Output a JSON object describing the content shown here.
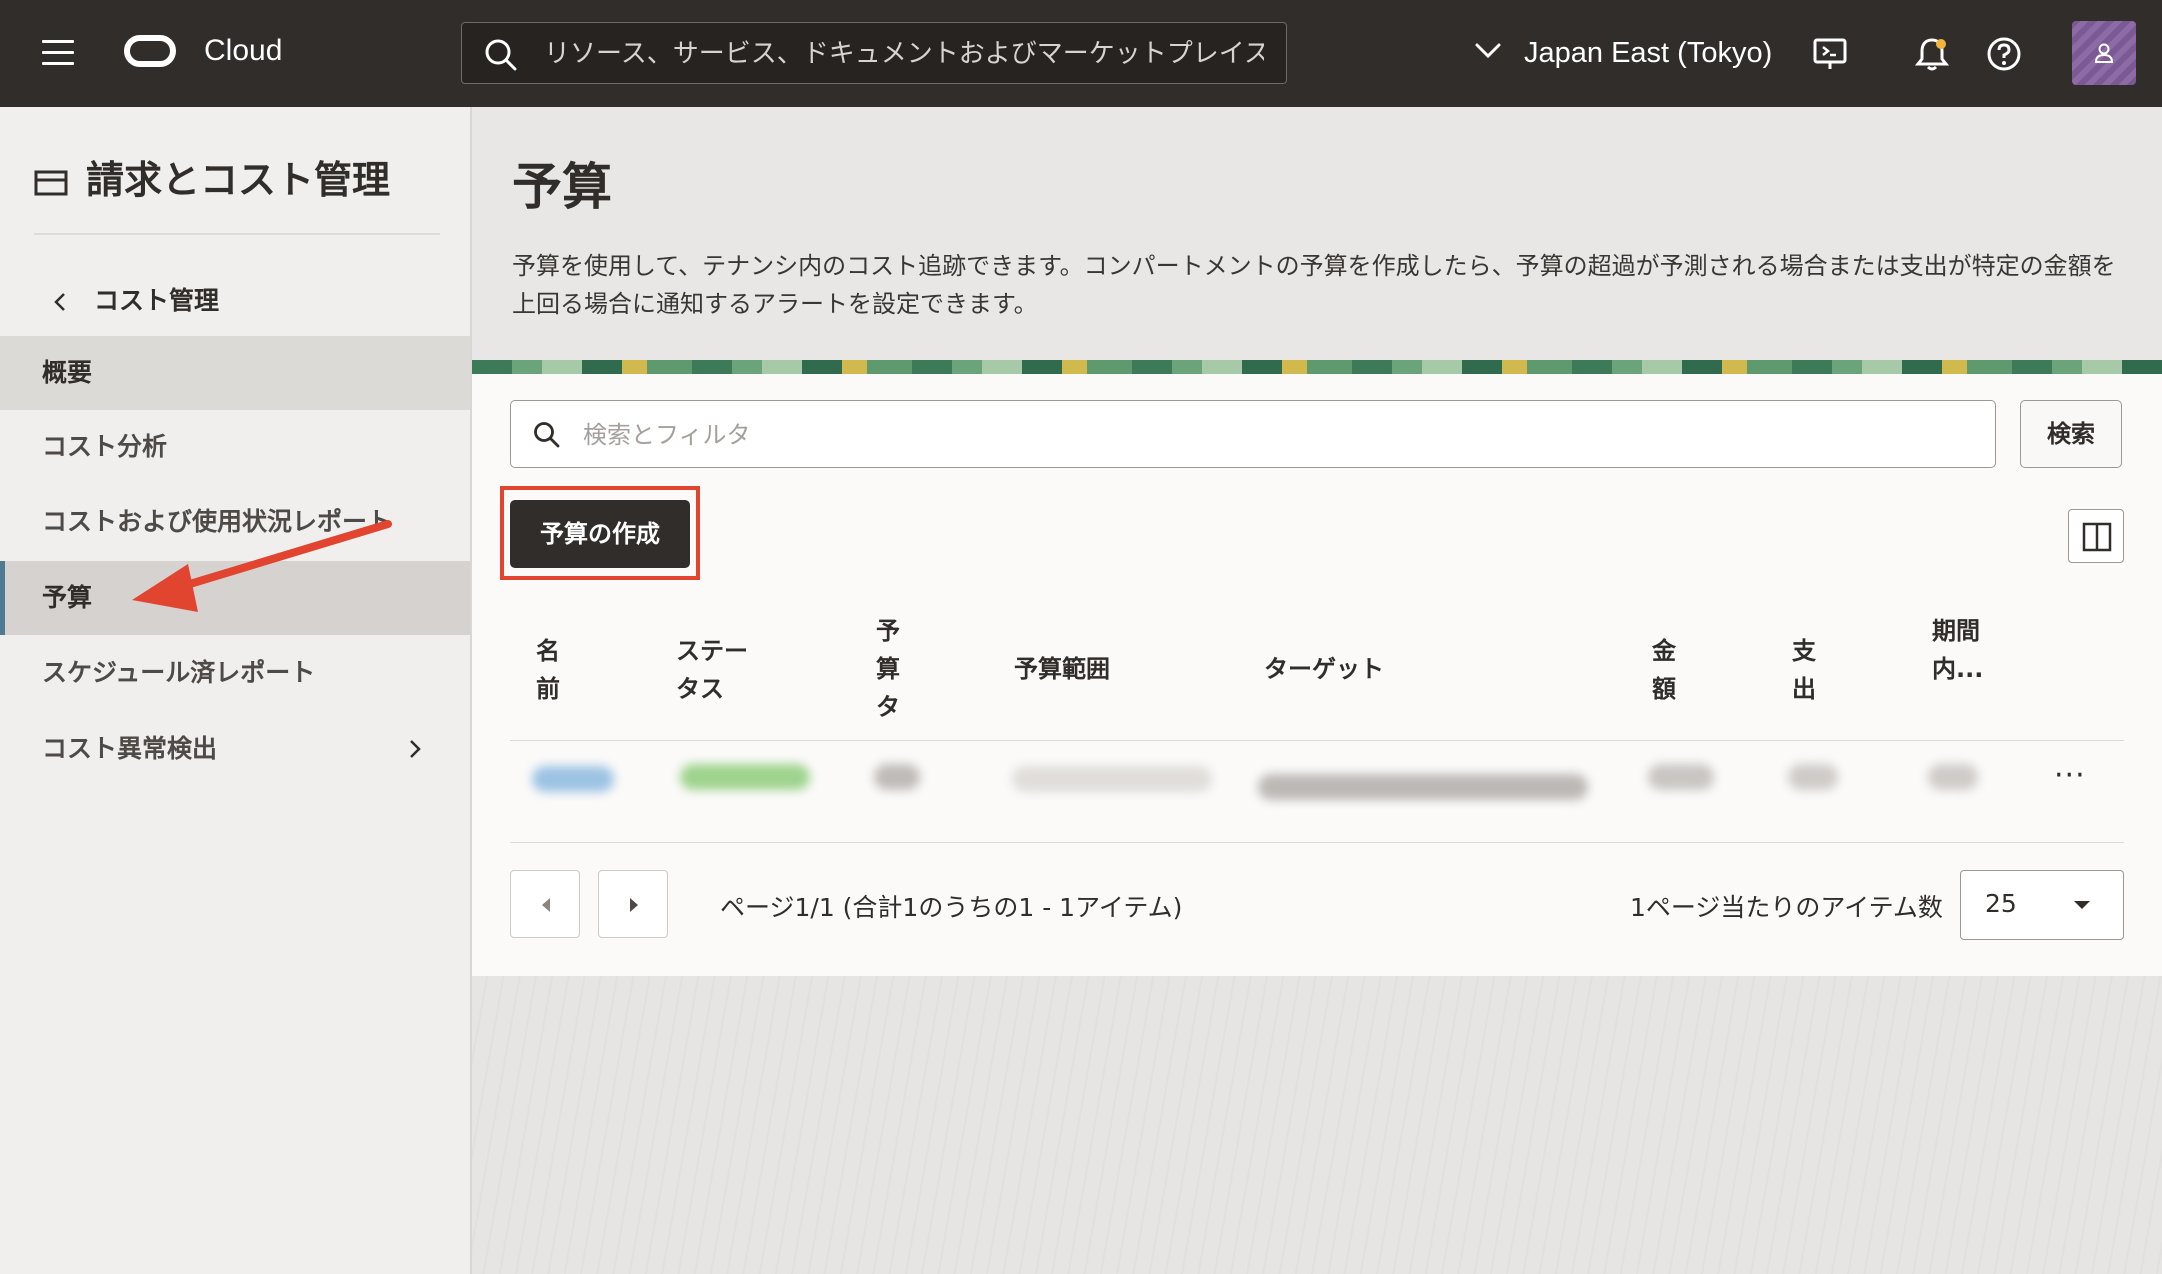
{
  "topbar": {
    "brand": "Cloud",
    "search_placeholder": "リソース、サービス、ドキュメントおよびマーケットプレイス",
    "region": "Japan East (Tokyo)"
  },
  "sidebar": {
    "title": "請求とコスト管理",
    "back_label": "コスト管理",
    "items": [
      {
        "label": "概要"
      },
      {
        "label": "コスト分析"
      },
      {
        "label": "コストおよび使用状況レポート"
      },
      {
        "label": "予算"
      },
      {
        "label": "スケジュール済レポート"
      },
      {
        "label": "コスト異常検出"
      }
    ]
  },
  "main": {
    "title": "予算",
    "description": "予算を使用して、テナンシ内のコスト追跡できます。コンパートメントの予算を作成したら、予算の超過が予測される場合または支出が特定の金額を上回る場合に通知するアラートを設定できます。",
    "filter_placeholder": "検索とフィルタ",
    "search_button": "検索",
    "create_button": "予算の作成",
    "table": {
      "columns": [
        "名前",
        "ステータス",
        "予算タ",
        "予算範囲",
        "ターゲット",
        "金額",
        "支出",
        "期間内..."
      ],
      "row_menu": "···"
    },
    "pagination": {
      "info": "ページ1/1 (合計1のうちの1 - 1アイテム)",
      "per_page_label": "1ページ当たりのアイテム数",
      "per_page_value": "25"
    }
  },
  "colors": {
    "topbar": "#312d2a",
    "highlight": "#e2452f",
    "active_indicator": "#4e7a92"
  }
}
